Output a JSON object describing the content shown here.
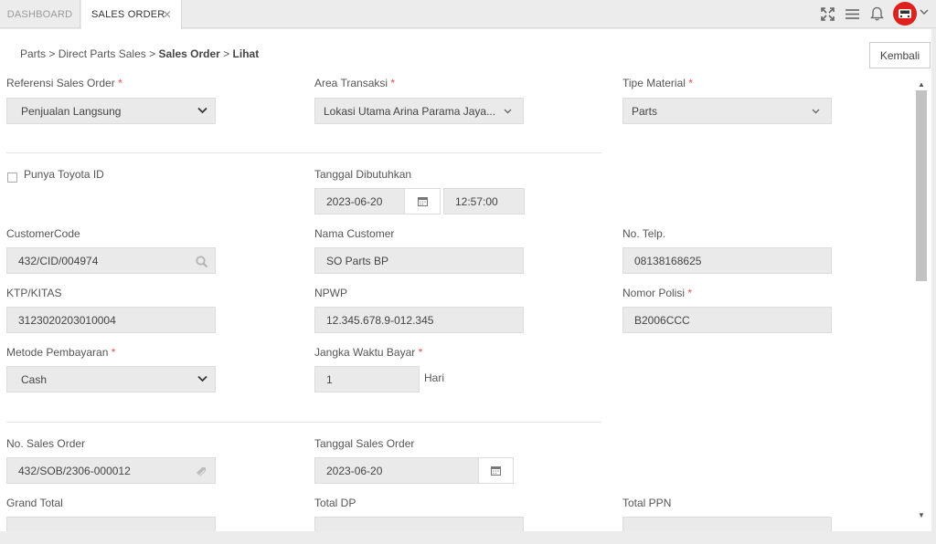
{
  "tabs": {
    "dashboard": "DASHBOARD",
    "sales_order": "SALES ORDER",
    "close": "✕"
  },
  "icons": {
    "fullscreen": "fullscreen-icon",
    "menu": "menu-icon",
    "bell": "bell-icon",
    "avatar": "car-avatar-icon",
    "caret": "chevron-down-icon"
  },
  "colors": {
    "accent": "#e0201e",
    "field_bg": "#eaeaea"
  },
  "breadcrumb": {
    "c1": "Parts",
    "c2": "Direct Parts Sales",
    "c3": "Sales Order",
    "c4": "Lihat",
    "sep": ">"
  },
  "back_button": "Kembali",
  "form": {
    "ref_sales_order": {
      "label": "Referensi Sales Order",
      "value": "Penjualan Langsung"
    },
    "area_transaksi": {
      "label": "Area Transaksi",
      "value": "Lokasi Utama Arina Parama Jaya..."
    },
    "tipe_material": {
      "label": "Tipe Material",
      "value": "Parts"
    },
    "toyota_id": {
      "label": "Punya Toyota ID"
    },
    "tanggal_dibutuhkan": {
      "label": "Tanggal Dibutuhkan",
      "date": "2023-06-20",
      "time": "12:57:00"
    },
    "customer_code": {
      "label": "CustomerCode",
      "value": "432/CID/004974"
    },
    "nama_customer": {
      "label": "Nama Customer",
      "value": "SO Parts BP"
    },
    "no_telp": {
      "label": "No. Telp.",
      "value": "08138168625"
    },
    "ktp": {
      "label": "KTP/KITAS",
      "value": "3123020203010004"
    },
    "npwp": {
      "label": "NPWP",
      "value": "12.345.678.9-012.345"
    },
    "nomor_polisi": {
      "label": "Nomor Polisi",
      "value": "B2006CCC"
    },
    "metode_bayar": {
      "label": "Metode Pembayaran",
      "value": "Cash"
    },
    "jangka_waktu": {
      "label": "Jangka Waktu Bayar",
      "value": "1",
      "unit": "Hari"
    },
    "no_sales_order": {
      "label": "No. Sales Order",
      "value": "432/SOB/2306-000012"
    },
    "tanggal_so": {
      "label": "Tanggal Sales Order",
      "value": "2023-06-20"
    },
    "grand_total": {
      "label": "Grand Total"
    },
    "total_dp": {
      "label": "Total DP"
    },
    "total_ppn": {
      "label": "Total PPN"
    }
  },
  "required_mark": "*"
}
